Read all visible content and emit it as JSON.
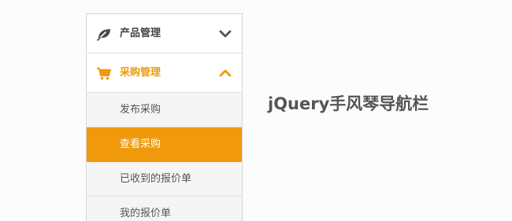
{
  "page": {
    "title": "jQuery手风琴导航栏"
  },
  "menu": {
    "sections": [
      {
        "label": "产品管理",
        "icon": "leaf-icon",
        "expanded": false
      },
      {
        "label": "采购管理",
        "icon": "cart-icon",
        "expanded": true,
        "items": [
          {
            "label": "发布采购",
            "active": false
          },
          {
            "label": "查看采购",
            "active": true
          },
          {
            "label": "已收到的报价单",
            "active": false
          },
          {
            "label": "我的报价单",
            "active": false
          }
        ]
      }
    ]
  },
  "colors": {
    "accent": "#f09a0b",
    "text": "#444444",
    "submenu_bg": "#f5f5f5",
    "border": "#d6d6d6",
    "page_bg": "#fcfcfc"
  }
}
